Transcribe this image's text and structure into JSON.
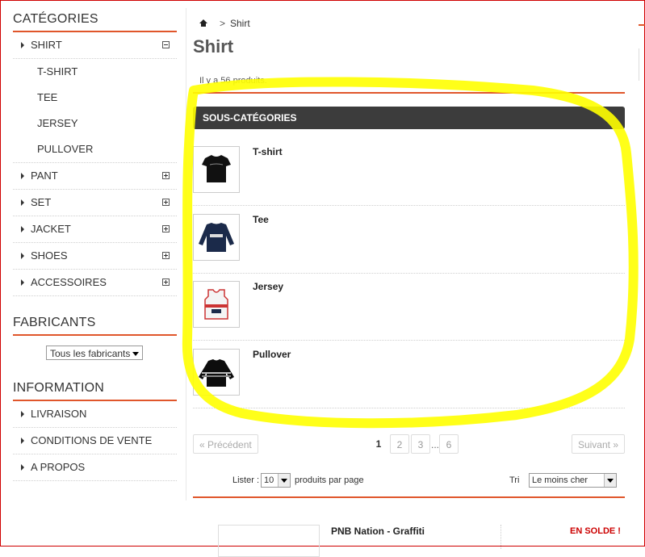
{
  "sidebar": {
    "categories_title": "CATÉGORIES",
    "categories": [
      {
        "label": "SHIRT",
        "expanded": true,
        "children": [
          "T-SHIRT",
          "TEE",
          "JERSEY",
          "PULLOVER"
        ]
      },
      {
        "label": "PANT",
        "expanded": false
      },
      {
        "label": "SET",
        "expanded": false
      },
      {
        "label": "JACKET",
        "expanded": false
      },
      {
        "label": "SHOES",
        "expanded": false
      },
      {
        "label": "ACCESSOIRES",
        "expanded": false
      }
    ],
    "manufacturers_title": "FABRICANTS",
    "manufacturers_select": "Tous les fabricants",
    "information_title": "INFORMATION",
    "information_links": [
      "LIVRAISON",
      "CONDITIONS DE VENTE",
      "A PROPOS"
    ]
  },
  "breadcrumb": {
    "separator": ">",
    "current": "Shirt"
  },
  "page_title": "Shirt",
  "product_count": "Il y a 56 produits.",
  "subcategories_title": "SOUS-CATÉGORIES",
  "subcategories": [
    {
      "name": "T-shirt",
      "thumb": "black-tshirt"
    },
    {
      "name": "Tee",
      "thumb": "navy-longsleeve"
    },
    {
      "name": "Jersey",
      "thumb": "white-red-jersey"
    },
    {
      "name": "Pullover",
      "thumb": "black-striped-pullover"
    }
  ],
  "pagination": {
    "prev": "« Précédent",
    "pages": [
      "1",
      "2",
      "3"
    ],
    "ellipsis": "...",
    "last": "6",
    "next": "Suivant »",
    "current": "1"
  },
  "listing": {
    "list_label": "Lister :",
    "per_page_value": "10",
    "per_page_suffix": "produits par page",
    "sort_label": "Tri",
    "sort_value": "Le moins cher"
  },
  "product_preview": {
    "name": "PNB Nation - Graffiti",
    "badge": "EN SOLDE !"
  },
  "colors": {
    "accent": "#e0562b",
    "bar": "#3c3c3c",
    "highlight": "#ffff00",
    "sale": "#cc0000"
  }
}
